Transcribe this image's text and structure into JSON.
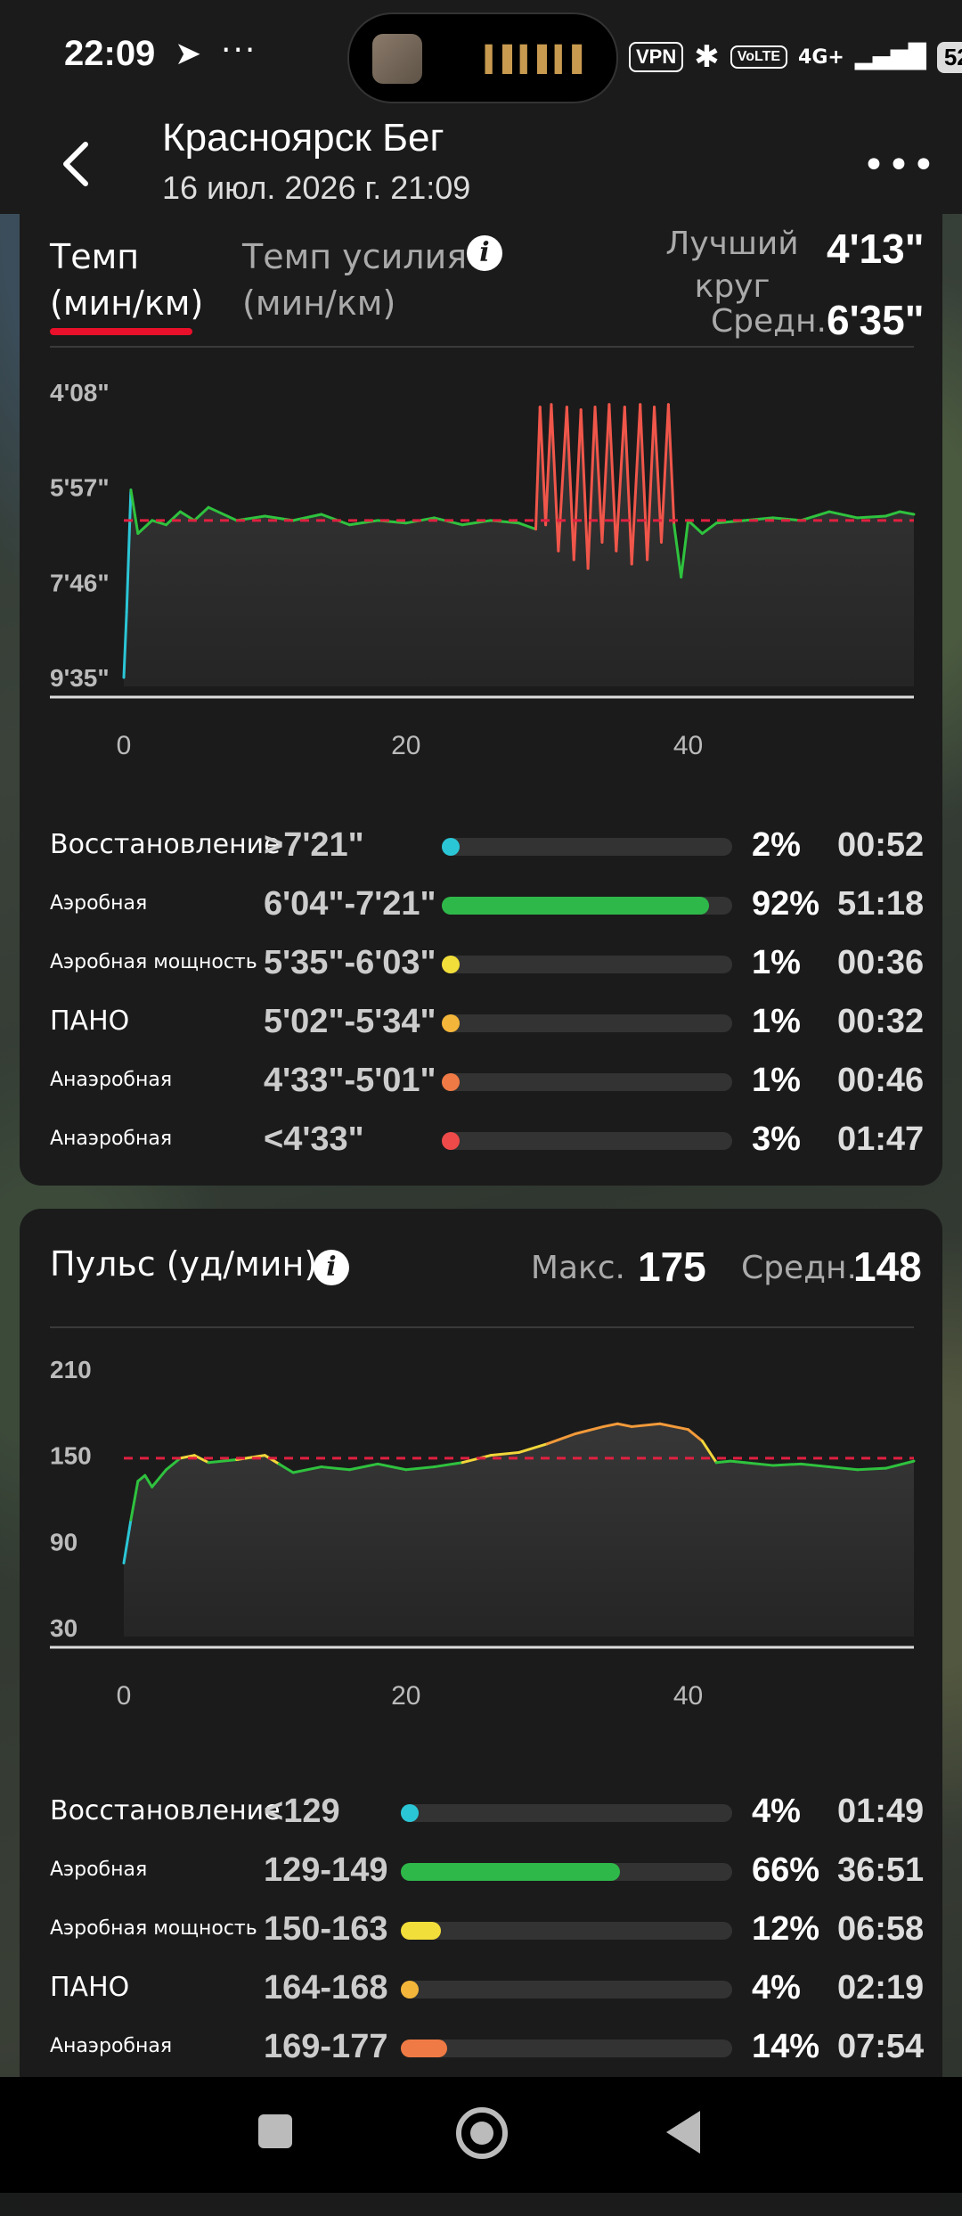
{
  "status": {
    "time": "22:09",
    "telegram_icon": "telegram-icon",
    "more_dots": "···",
    "vpn": "VPN",
    "volte": "VoLTE",
    "network": "4G+",
    "battery": "52"
  },
  "header": {
    "title": "Красноярск Бег",
    "subtitle": "16 июл. 2026 г. 21:09"
  },
  "pace": {
    "tab_active": [
      "Темп",
      "(мин/км)"
    ],
    "tab_inactive": [
      "Темп усилия",
      "(мин/км)"
    ],
    "best_lap_label": [
      "Лучший",
      "круг"
    ],
    "best_lap_value": "4'13\"",
    "avg_label": "Средн.",
    "avg_value": "6'35\"",
    "chart_data": {
      "type": "line",
      "y_tick_labels": [
        "4'08\"",
        "5'57\"",
        "7'46\"",
        "9'35\""
      ],
      "x_tick_labels": [
        "0",
        "20",
        "40"
      ],
      "xlim": [
        0,
        56
      ],
      "ylim_seconds": [
        248,
        575
      ],
      "avg_line_seconds": 395,
      "note_y_inverted": true,
      "x": [
        0,
        0.2,
        0.5,
        1,
        2,
        3,
        4,
        5,
        6,
        8,
        10,
        12,
        14,
        16,
        18,
        20,
        22,
        24,
        26,
        28,
        29.2,
        29.5,
        29.9,
        30.3,
        30.8,
        31.4,
        31.9,
        32.4,
        32.9,
        33.4,
        33.9,
        34.4,
        34.9,
        35.5,
        36,
        36.6,
        37.1,
        37.6,
        38.1,
        38.6,
        39,
        39.5,
        40,
        41,
        42,
        44,
        46,
        48,
        50,
        52,
        54,
        55,
        56
      ],
      "y": [
        575,
        500,
        360,
        410,
        395,
        400,
        385,
        395,
        380,
        395,
        390,
        395,
        388,
        400,
        395,
        398,
        392,
        400,
        395,
        398,
        405,
        265,
        400,
        262,
        430,
        265,
        440,
        268,
        450,
        265,
        420,
        262,
        430,
        265,
        445,
        262,
        440,
        265,
        420,
        262,
        400,
        460,
        395,
        410,
        398,
        395,
        392,
        395,
        385,
        392,
        390,
        385,
        388
      ]
    },
    "zones": [
      {
        "name": "Восстановление",
        "range": ">7'21\"",
        "pct": "2%",
        "pct_val": 2,
        "time": "00:52",
        "color": "#2bc6d6"
      },
      {
        "name": "Аэробная",
        "range": "6'04\"-7'21\"",
        "pct": "92%",
        "pct_val": 92,
        "time": "51:18",
        "color": "#2fb84a"
      },
      {
        "name": "Аэробная мощность",
        "range": "5'35\"-6'03\"",
        "pct": "1%",
        "pct_val": 1,
        "time": "00:36",
        "color": "#f2de3a"
      },
      {
        "name": "ПАНО",
        "range": "5'02\"-5'34\"",
        "pct": "1%",
        "pct_val": 1,
        "time": "00:32",
        "color": "#f4b63a"
      },
      {
        "name": "Анаэробная",
        "range": "4'33\"-5'01\"",
        "pct": "1%",
        "pct_val": 1,
        "time": "00:46",
        "color": "#f07a45"
      },
      {
        "name": "Анаэробная",
        "range": "<4'33\"",
        "pct": "3%",
        "pct_val": 3,
        "time": "01:47",
        "color": "#ee4a4a"
      }
    ]
  },
  "hr": {
    "title": "Пульс (уд/мин)",
    "max_label": "Макс.",
    "max_value": "175",
    "avg_label": "Средн.",
    "avg_value": "148",
    "chart_data": {
      "type": "line",
      "y_tick_labels": [
        "210",
        "150",
        "90",
        "30"
      ],
      "x_tick_labels": [
        "0",
        "20",
        "40"
      ],
      "ylim": [
        30,
        210
      ],
      "xlim": [
        0,
        56
      ],
      "avg_line": 148,
      "x": [
        0,
        0.5,
        1,
        1.5,
        2,
        3,
        4,
        5,
        6,
        8,
        10,
        11,
        12,
        14,
        16,
        18,
        20,
        22,
        24,
        26,
        28,
        30,
        32,
        34,
        35,
        36,
        38,
        40,
        41,
        42,
        43,
        44,
        46,
        48,
        50,
        52,
        54,
        56
      ],
      "y": [
        75,
        105,
        132,
        136,
        128,
        140,
        148,
        150,
        145,
        147,
        150,
        144,
        138,
        142,
        140,
        144,
        140,
        142,
        145,
        150,
        152,
        158,
        165,
        170,
        172,
        170,
        172,
        168,
        160,
        145,
        146,
        145,
        143,
        144,
        142,
        140,
        141,
        146
      ]
    },
    "zones": [
      {
        "name": "Восстановление",
        "range": "<129",
        "pct": "4%",
        "pct_val": 4,
        "time": "01:49",
        "color": "#2bc6d6"
      },
      {
        "name": "Аэробная",
        "range": "129-149",
        "pct": "66%",
        "pct_val": 66,
        "time": "36:51",
        "color": "#2fb84a"
      },
      {
        "name": "Аэробная мощность",
        "range": "150-163",
        "pct": "12%",
        "pct_val": 12,
        "time": "06:58",
        "color": "#f2de3a"
      },
      {
        "name": "ПАНО",
        "range": "164-168",
        "pct": "4%",
        "pct_val": 4,
        "time": "02:19",
        "color": "#f4b63a"
      },
      {
        "name": "Анаэробная",
        "range": "169-177",
        "pct": "14%",
        "pct_val": 14,
        "time": "07:54",
        "color": "#f07a45"
      }
    ]
  }
}
